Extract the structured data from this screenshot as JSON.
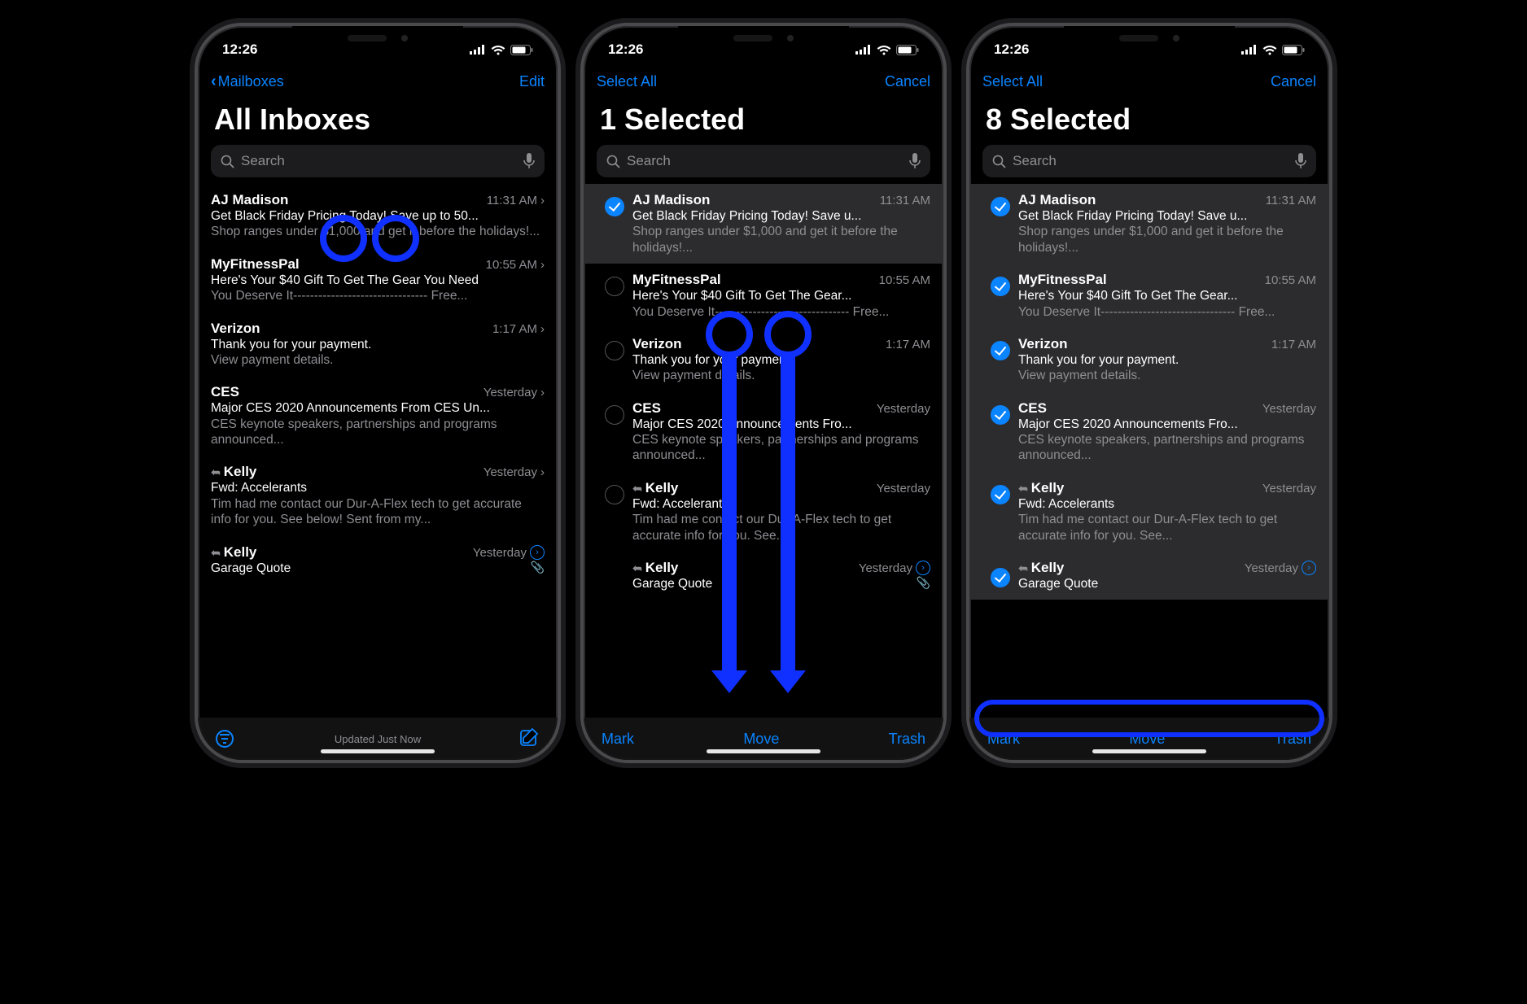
{
  "status": {
    "time": "12:26"
  },
  "nav": {
    "back": "Mailboxes",
    "edit": "Edit",
    "selectAll": "Select All",
    "cancel": "Cancel"
  },
  "titles": {
    "allInboxes": "All Inboxes",
    "sel1": "1 Selected",
    "sel8": "8 Selected"
  },
  "search": {
    "placeholder": "Search"
  },
  "toolbar": {
    "mark": "Mark",
    "move": "Move",
    "trash": "Trash",
    "updated": "Updated Just Now"
  },
  "emails": [
    {
      "sender": "AJ Madison",
      "time": "11:31 AM",
      "subjectFull": "Get Black Friday Pricing Today! Save up to 50...",
      "subjectTrunc": "Get Black Friday Pricing Today! Save u...",
      "preview": "Shop ranges under $1,000 and get it before the holidays!..."
    },
    {
      "sender": "MyFitnessPal",
      "time": "10:55 AM",
      "subjectFull": "Here's Your $40 Gift To Get The Gear You Need",
      "subjectTrunc": "Here's Your $40 Gift To Get The Gear...",
      "preview": "You Deserve\nIt-------------------------------- Free..."
    },
    {
      "sender": "Verizon",
      "time": "1:17 AM",
      "subjectFull": "Thank you for your payment.",
      "subjectTrunc": "Thank you for your payment.",
      "preview": "View payment details."
    },
    {
      "sender": "CES",
      "time": "Yesterday",
      "subjectFull": "Major CES 2020 Announcements From CES Un...",
      "subjectTrunc": "Major CES 2020 Announcements Fro...",
      "preview": "CES keynote speakers, partnerships and programs announced..."
    },
    {
      "sender": "Kelly",
      "time": "Yesterday",
      "reply": true,
      "subjectFull": "Fwd: Accelerants",
      "subjectTrunc": "Fwd: Accelerants",
      "preview": "Tim had me contact our Dur-A-Flex tech to get accurate info for you. See below! Sent from my...",
      "previewTrunc": "Tim had me contact our Dur-A-Flex tech to get accurate info for you. See..."
    },
    {
      "sender": "Kelly",
      "time": "Yesterday",
      "reply": true,
      "thread": true,
      "clip": true,
      "subjectFull": "Garage Quote",
      "subjectTrunc": "Garage Quote",
      "preview": ""
    }
  ]
}
